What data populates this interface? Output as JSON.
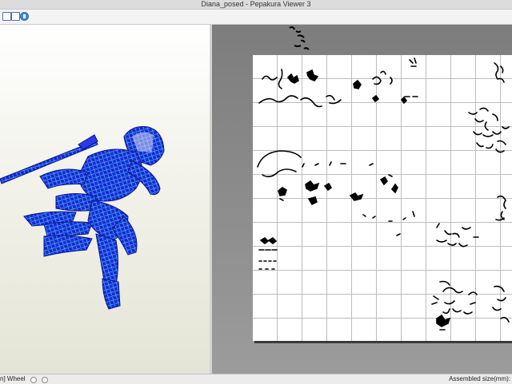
{
  "window": {
    "title": "Diana_posed - Pepakura Viewer 3"
  },
  "toolbar": {
    "buttons": [
      "window-icon",
      "window-icon",
      "info-icon"
    ]
  },
  "viewport3d": {
    "background": "#f2f2ea",
    "model_color": "#1f2fe0",
    "edge_color": "#39b6ff"
  },
  "viewport2d": {
    "background": "#8f8f8f",
    "sheet_color": "#ffffff"
  },
  "statusbar": {
    "left_text": "n] Wheel",
    "right_text": "Assembled size(mm): "
  }
}
